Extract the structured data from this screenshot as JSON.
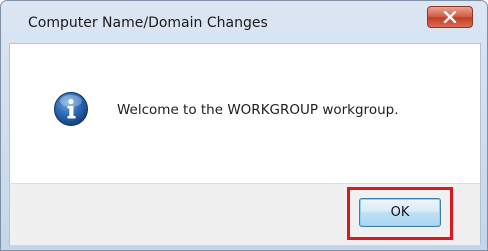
{
  "dialog": {
    "title": "Computer Name/Domain Changes",
    "message": "Welcome to the WORKGROUP workgroup.",
    "icon": "information-icon",
    "close_icon": "close-icon",
    "ok_label": "OK"
  },
  "colors": {
    "highlight": "#d71920",
    "close_button": "#c8472f",
    "info_icon": "#1f5fa8"
  }
}
